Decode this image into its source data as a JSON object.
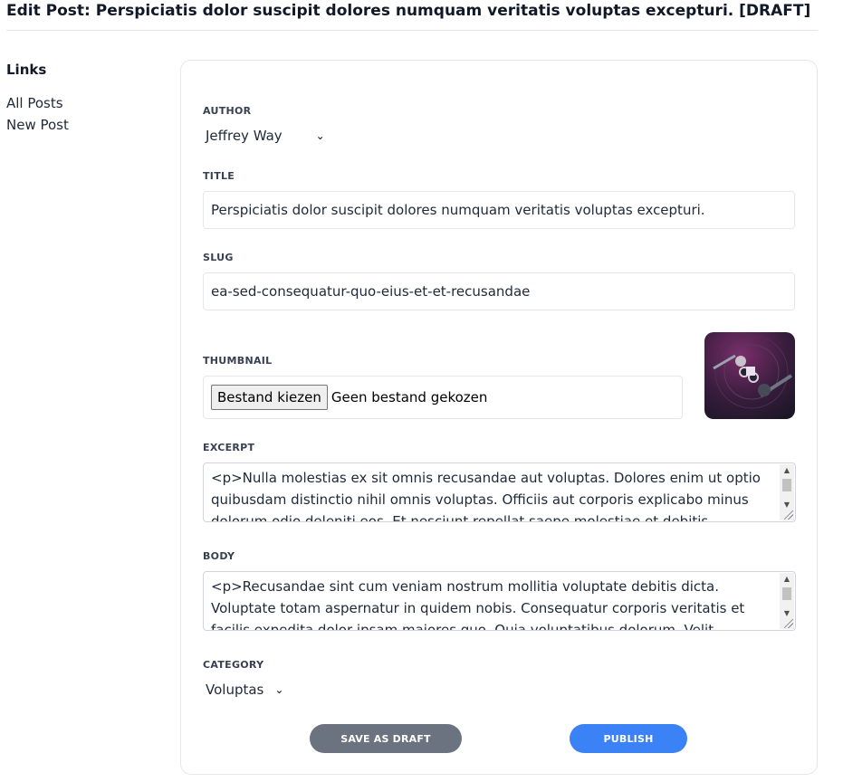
{
  "header": {
    "title": "Edit Post: Perspiciatis dolor suscipit dolores numquam veritatis voluptas excepturi. [DRAFT]"
  },
  "sidebar": {
    "heading": "Links",
    "links": [
      {
        "label": "All Posts"
      },
      {
        "label": "New Post"
      }
    ]
  },
  "form": {
    "author": {
      "label": "AUTHOR",
      "value": "Jeffrey Way"
    },
    "title": {
      "label": "TITLE",
      "value": "Perspiciatis dolor suscipit dolores numquam veritatis voluptas excepturi."
    },
    "slug": {
      "label": "SLUG",
      "value": "ea-sed-consequatur-quo-eius-et-et-recusandae"
    },
    "thumbnail": {
      "label": "THUMBNAIL",
      "button_label": "Bestand kiezen",
      "status": "Geen bestand gekozen"
    },
    "excerpt": {
      "label": "EXCERPT",
      "value": "<p>Nulla molestias ex sit omnis recusandae aut voluptas. Dolores enim ut optio quibusdam distinctio nihil omnis voluptas. Officiis aut corporis explicabo minus dolorum odio deleniti eos. Et nesciunt repellat saepe molestiae et debitis."
    },
    "body": {
      "label": "BODY",
      "value": "<p>Recusandae sint cum veniam nostrum mollitia voluptate debitis dicta. Voluptate totam aspernatur in quidem nobis. Consequatur corporis veritatis et facilis expedita dolor ipsam maiores quo. Quia voluptatibus dolorum. Velit."
    },
    "category": {
      "label": "CATEGORY",
      "value": "Voluptas"
    },
    "actions": {
      "save_draft": "Save as Draft",
      "publish": "Publish"
    }
  },
  "colors": {
    "publish_button": "#3b82f6",
    "draft_button": "#6b7280"
  }
}
